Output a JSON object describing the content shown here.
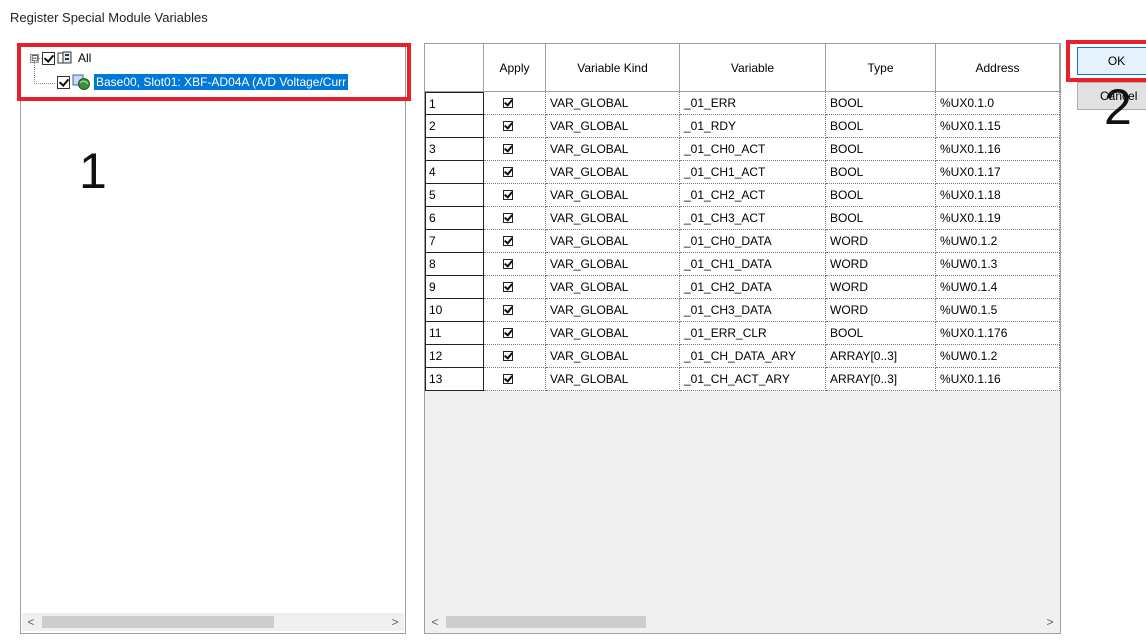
{
  "window": {
    "title": "Register Special Module Variables"
  },
  "tree": {
    "root": {
      "label": "All",
      "expander": "⊟",
      "checked": true,
      "icon": "module-group-icon"
    },
    "child": {
      "label": "Base00, Slot01: XBF-AD04A (A/D Voltage/Curr",
      "checked": true,
      "icon": "analog-module-icon",
      "selected": true
    }
  },
  "annotations": {
    "one": "1",
    "two": "2"
  },
  "grid": {
    "columns": [
      "",
      "Apply",
      "Variable Kind",
      "Variable",
      "Type",
      "Address"
    ],
    "rows": [
      {
        "n": "1",
        "apply": true,
        "kind": "VAR_GLOBAL",
        "variable": "_01_ERR",
        "type": "BOOL",
        "address": "%UX0.1.0"
      },
      {
        "n": "2",
        "apply": true,
        "kind": "VAR_GLOBAL",
        "variable": "_01_RDY",
        "type": "BOOL",
        "address": "%UX0.1.15"
      },
      {
        "n": "3",
        "apply": true,
        "kind": "VAR_GLOBAL",
        "variable": "_01_CH0_ACT",
        "type": "BOOL",
        "address": "%UX0.1.16"
      },
      {
        "n": "4",
        "apply": true,
        "kind": "VAR_GLOBAL",
        "variable": "_01_CH1_ACT",
        "type": "BOOL",
        "address": "%UX0.1.17"
      },
      {
        "n": "5",
        "apply": true,
        "kind": "VAR_GLOBAL",
        "variable": "_01_CH2_ACT",
        "type": "BOOL",
        "address": "%UX0.1.18"
      },
      {
        "n": "6",
        "apply": true,
        "kind": "VAR_GLOBAL",
        "variable": "_01_CH3_ACT",
        "type": "BOOL",
        "address": "%UX0.1.19"
      },
      {
        "n": "7",
        "apply": true,
        "kind": "VAR_GLOBAL",
        "variable": "_01_CH0_DATA",
        "type": "WORD",
        "address": "%UW0.1.2"
      },
      {
        "n": "8",
        "apply": true,
        "kind": "VAR_GLOBAL",
        "variable": "_01_CH1_DATA",
        "type": "WORD",
        "address": "%UW0.1.3"
      },
      {
        "n": "9",
        "apply": true,
        "kind": "VAR_GLOBAL",
        "variable": "_01_CH2_DATA",
        "type": "WORD",
        "address": "%UW0.1.4"
      },
      {
        "n": "10",
        "apply": true,
        "kind": "VAR_GLOBAL",
        "variable": "_01_CH3_DATA",
        "type": "WORD",
        "address": "%UW0.1.5"
      },
      {
        "n": "11",
        "apply": true,
        "kind": "VAR_GLOBAL",
        "variable": "_01_ERR_CLR",
        "type": "BOOL",
        "address": "%UX0.1.176"
      },
      {
        "n": "12",
        "apply": true,
        "kind": "VAR_GLOBAL",
        "variable": "_01_CH_DATA_ARY",
        "type": "ARRAY[0..3]",
        "address": "%UW0.1.2"
      },
      {
        "n": "13",
        "apply": true,
        "kind": "VAR_GLOBAL",
        "variable": "_01_CH_ACT_ARY",
        "type": "ARRAY[0..3]",
        "address": "%UX0.1.16"
      }
    ]
  },
  "buttons": {
    "ok": "OK",
    "cancel": "Cancel"
  },
  "scroll": {
    "left_arrow": "<",
    "right_arrow": ">"
  },
  "colors": {
    "highlight": "#e8202a",
    "selection": "#0078d7"
  }
}
